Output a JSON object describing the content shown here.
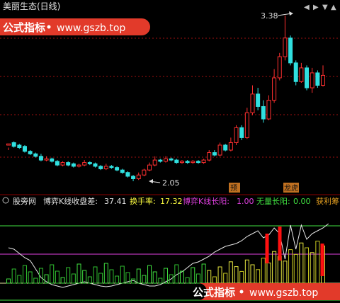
{
  "main_chart": {
    "title": "美丽生态(日线)",
    "high_marker": "3.38",
    "low_marker": "2.05",
    "event_tag_1": "预",
    "event_tag_2": "龙虎"
  },
  "watermarks": [
    {
      "label": "公式指标",
      "url": "www.gszb.top"
    },
    {
      "label": "公式指标",
      "url": "www.gszb.top"
    }
  ],
  "indicator": {
    "name": "股旁网",
    "items": [
      {
        "label": "博弈K线收盘差:",
        "value": "37.41",
        "color": "#e6e6e6"
      },
      {
        "label": "换手率:",
        "value": "17.32",
        "color": "#ffff40"
      },
      {
        "label": "博弈K线长阳:",
        "value": "1.00",
        "color": "#e040e0"
      },
      {
        "label": "无量长阳:",
        "value": "0.00",
        "color": "#40e040"
      },
      {
        "label": "获利筹",
        "value": "",
        "color": "#e6a020"
      }
    ]
  },
  "colors": {
    "up": "#ff3030",
    "down": "#30e0e0",
    "grid": "#a01010",
    "separator": "#8a0000",
    "watermark_bg": "#e23a2a"
  },
  "chart_data": {
    "type": "candlestick",
    "title": "美丽生态(日线)",
    "price_high": 3.38,
    "price_low": 2.05,
    "candles": [
      [
        2.34,
        2.35,
        2.32,
        2.3
      ],
      [
        2.36,
        2.33,
        2.37,
        2.32
      ],
      [
        2.34,
        2.32,
        2.35,
        2.31
      ],
      [
        2.33,
        2.29,
        2.34,
        2.28
      ],
      [
        2.29,
        2.27,
        2.3,
        2.26
      ],
      [
        2.27,
        2.25,
        2.28,
        2.24
      ],
      [
        2.25,
        2.22,
        2.27,
        2.21
      ],
      [
        2.22,
        2.23,
        2.25,
        2.21
      ],
      [
        2.23,
        2.21,
        2.24,
        2.2
      ],
      [
        2.21,
        2.18,
        2.22,
        2.17
      ],
      [
        2.18,
        2.2,
        2.21,
        2.17
      ],
      [
        2.2,
        2.18,
        2.21,
        2.17
      ],
      [
        2.19,
        2.17,
        2.2,
        2.16
      ],
      [
        2.17,
        2.18,
        2.19,
        2.16
      ],
      [
        2.18,
        2.2,
        2.22,
        2.17
      ],
      [
        2.2,
        2.19,
        2.21,
        2.18
      ],
      [
        2.19,
        2.17,
        2.2,
        2.16
      ],
      [
        2.17,
        2.15,
        2.18,
        2.14
      ],
      [
        2.15,
        2.17,
        2.19,
        2.14
      ],
      [
        2.17,
        2.16,
        2.18,
        2.15
      ],
      [
        2.16,
        2.14,
        2.17,
        2.13
      ],
      [
        2.14,
        2.12,
        2.15,
        2.11
      ],
      [
        2.12,
        2.09,
        2.13,
        2.08
      ],
      [
        2.09,
        2.07,
        2.1,
        2.05
      ],
      [
        2.07,
        2.1,
        2.12,
        2.06
      ],
      [
        2.1,
        2.14,
        2.15,
        2.09
      ],
      [
        2.14,
        2.18,
        2.2,
        2.13
      ],
      [
        2.18,
        2.22,
        2.25,
        2.17
      ],
      [
        2.22,
        2.21,
        2.23,
        2.2
      ],
      [
        2.21,
        2.23,
        2.25,
        2.2
      ],
      [
        2.23,
        2.22,
        2.24,
        2.21
      ],
      [
        2.22,
        2.2,
        2.23,
        2.19
      ],
      [
        2.2,
        2.21,
        2.22,
        2.19
      ],
      [
        2.21,
        2.2,
        2.22,
        2.19
      ],
      [
        2.2,
        2.21,
        2.22,
        2.19
      ],
      [
        2.21,
        2.2,
        2.22,
        2.19
      ],
      [
        2.2,
        2.22,
        2.23,
        2.19
      ],
      [
        2.22,
        2.28,
        2.3,
        2.21
      ],
      [
        2.28,
        2.26,
        2.3,
        2.25
      ],
      [
        2.26,
        2.34,
        2.36,
        2.25
      ],
      [
        2.34,
        2.3,
        2.35,
        2.29
      ],
      [
        2.3,
        2.36,
        2.4,
        2.29
      ],
      [
        2.36,
        2.48,
        2.5,
        2.34
      ],
      [
        2.48,
        2.4,
        2.5,
        2.38
      ],
      [
        2.4,
        2.6,
        2.64,
        2.39
      ],
      [
        2.6,
        2.75,
        2.82,
        2.58
      ],
      [
        2.75,
        2.65,
        2.8,
        2.62
      ],
      [
        2.65,
        2.55,
        2.7,
        2.52
      ],
      [
        2.55,
        2.7,
        2.74,
        2.54
      ],
      [
        2.7,
        2.88,
        2.95,
        2.68
      ],
      [
        2.88,
        3.05,
        3.08,
        2.86
      ],
      [
        3.05,
        3.2,
        3.38,
        3.02
      ],
      [
        3.2,
        3.0,
        3.22,
        2.98
      ],
      [
        3.0,
        2.85,
        3.02,
        2.82
      ],
      [
        2.85,
        2.96,
        3.0,
        2.84
      ],
      [
        2.96,
        2.8,
        2.98,
        2.78
      ],
      [
        2.8,
        2.92,
        2.96,
        2.76
      ],
      [
        2.92,
        2.82,
        2.94,
        2.8
      ],
      [
        2.82,
        2.9,
        2.98,
        2.81
      ]
    ]
  }
}
